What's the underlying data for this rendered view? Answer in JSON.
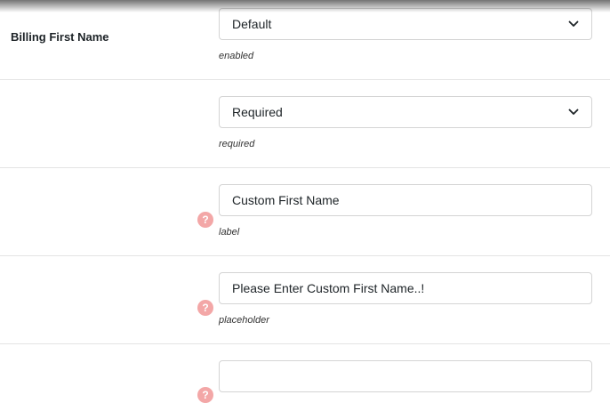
{
  "rows": [
    {
      "label": "Billing First Name",
      "control_type": "select",
      "value": "Default",
      "description": "enabled",
      "help": false
    },
    {
      "label": "",
      "control_type": "select",
      "value": "Required",
      "description": "required",
      "help": false
    },
    {
      "label": "",
      "control_type": "input",
      "value": "Custom First Name",
      "description": "label",
      "help": true
    },
    {
      "label": "",
      "control_type": "input",
      "value": "Please Enter Custom First Name..!",
      "description": "placeholder",
      "help": true
    },
    {
      "label": "",
      "control_type": "input",
      "value": "",
      "description": "",
      "help": true
    }
  ],
  "help_icon_glyph": "?",
  "colors": {
    "help_icon": "#f3a7a7",
    "border": "#d4d4d4",
    "divider": "#e4e4e4"
  }
}
